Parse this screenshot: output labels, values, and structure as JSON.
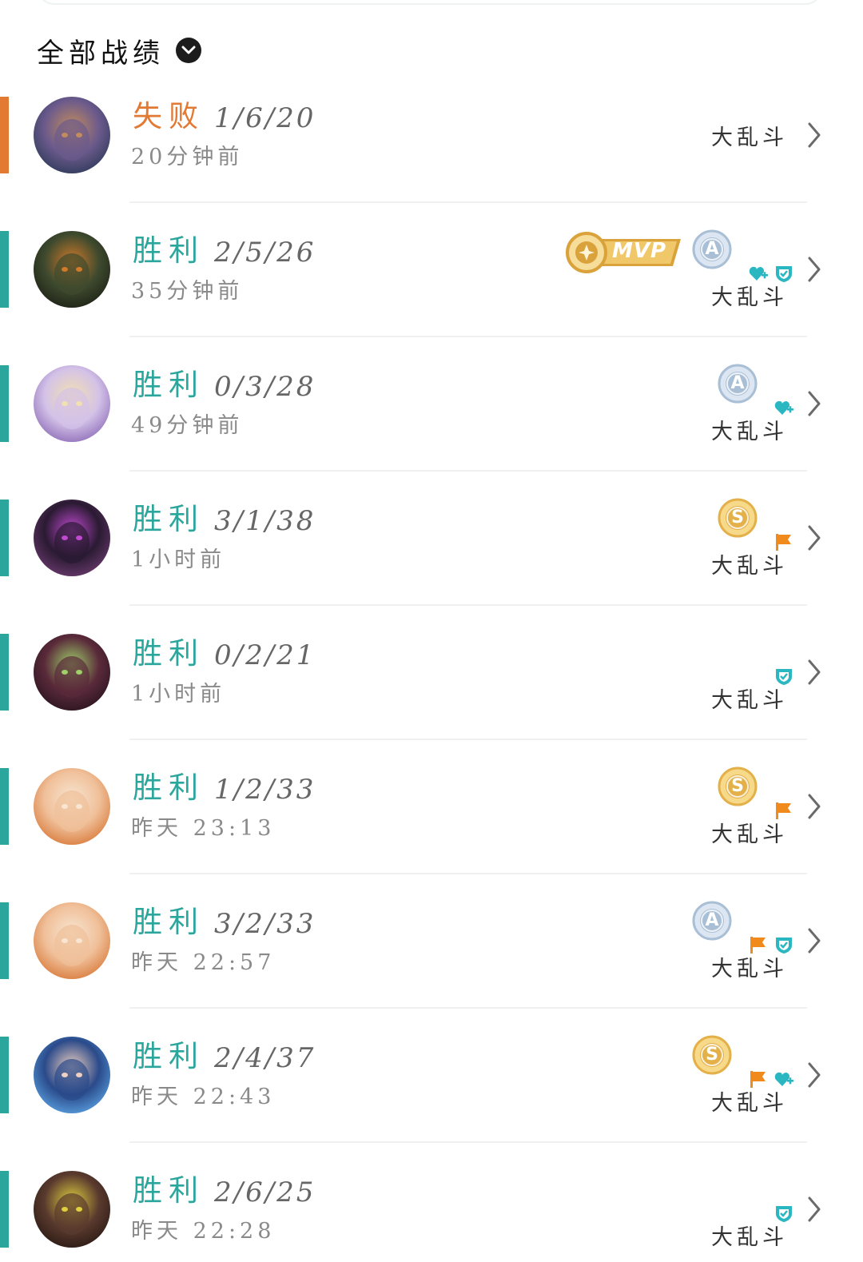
{
  "header": {
    "title": "全部战绩",
    "dropdown_icon": "chevron-down-circle-icon"
  },
  "colors": {
    "win": "#2aa69c",
    "loss": "#e37a34",
    "mvp_gold": "#d9a23b",
    "medal_silver": "#a9bfd6",
    "medal_gold": "#e3b04a",
    "flag_orange": "#f08a1c",
    "heart_teal": "#2ab7c2"
  },
  "matches": [
    {
      "result": "失败",
      "kda": "1/6/20",
      "time": "20分钟前",
      "mode": "大乱斗",
      "mvp": false,
      "medal": null,
      "icons": []
    },
    {
      "result": "胜利",
      "kda": "2/5/26",
      "time": "35分钟前",
      "mode": "大乱斗",
      "mvp": true,
      "mvp_label": "MVP",
      "medal": "A",
      "icons": [
        "heart-plus-icon",
        "shield-icon"
      ]
    },
    {
      "result": "胜利",
      "kda": "0/3/28",
      "time": "49分钟前",
      "mode": "大乱斗",
      "mvp": false,
      "medal": "A",
      "icons": [
        "heart-plus-icon"
      ]
    },
    {
      "result": "胜利",
      "kda": "3/1/38",
      "time": "1小时前",
      "mode": "大乱斗",
      "mvp": false,
      "medal": "S",
      "icons": [
        "flag-icon"
      ]
    },
    {
      "result": "胜利",
      "kda": "0/2/21",
      "time": "1小时前",
      "mode": "大乱斗",
      "mvp": false,
      "medal": null,
      "icons": [
        "shield-icon"
      ]
    },
    {
      "result": "胜利",
      "kda": "1/2/33",
      "time": "昨天 23:13",
      "mode": "大乱斗",
      "mvp": false,
      "medal": "S",
      "icons": [
        "flag-icon"
      ]
    },
    {
      "result": "胜利",
      "kda": "3/2/33",
      "time": "昨天 22:57",
      "mode": "大乱斗",
      "mvp": false,
      "medal": "A",
      "icons": [
        "flag-icon",
        "shield-icon"
      ]
    },
    {
      "result": "胜利",
      "kda": "2/4/37",
      "time": "昨天 22:43",
      "mode": "大乱斗",
      "mvp": false,
      "medal": "S",
      "icons": [
        "flag-icon",
        "heart-plus-icon"
      ]
    },
    {
      "result": "胜利",
      "kda": "2/6/25",
      "time": "昨天 22:28",
      "mode": "大乱斗",
      "mvp": false,
      "medal": null,
      "icons": [
        "shield-icon"
      ]
    }
  ]
}
